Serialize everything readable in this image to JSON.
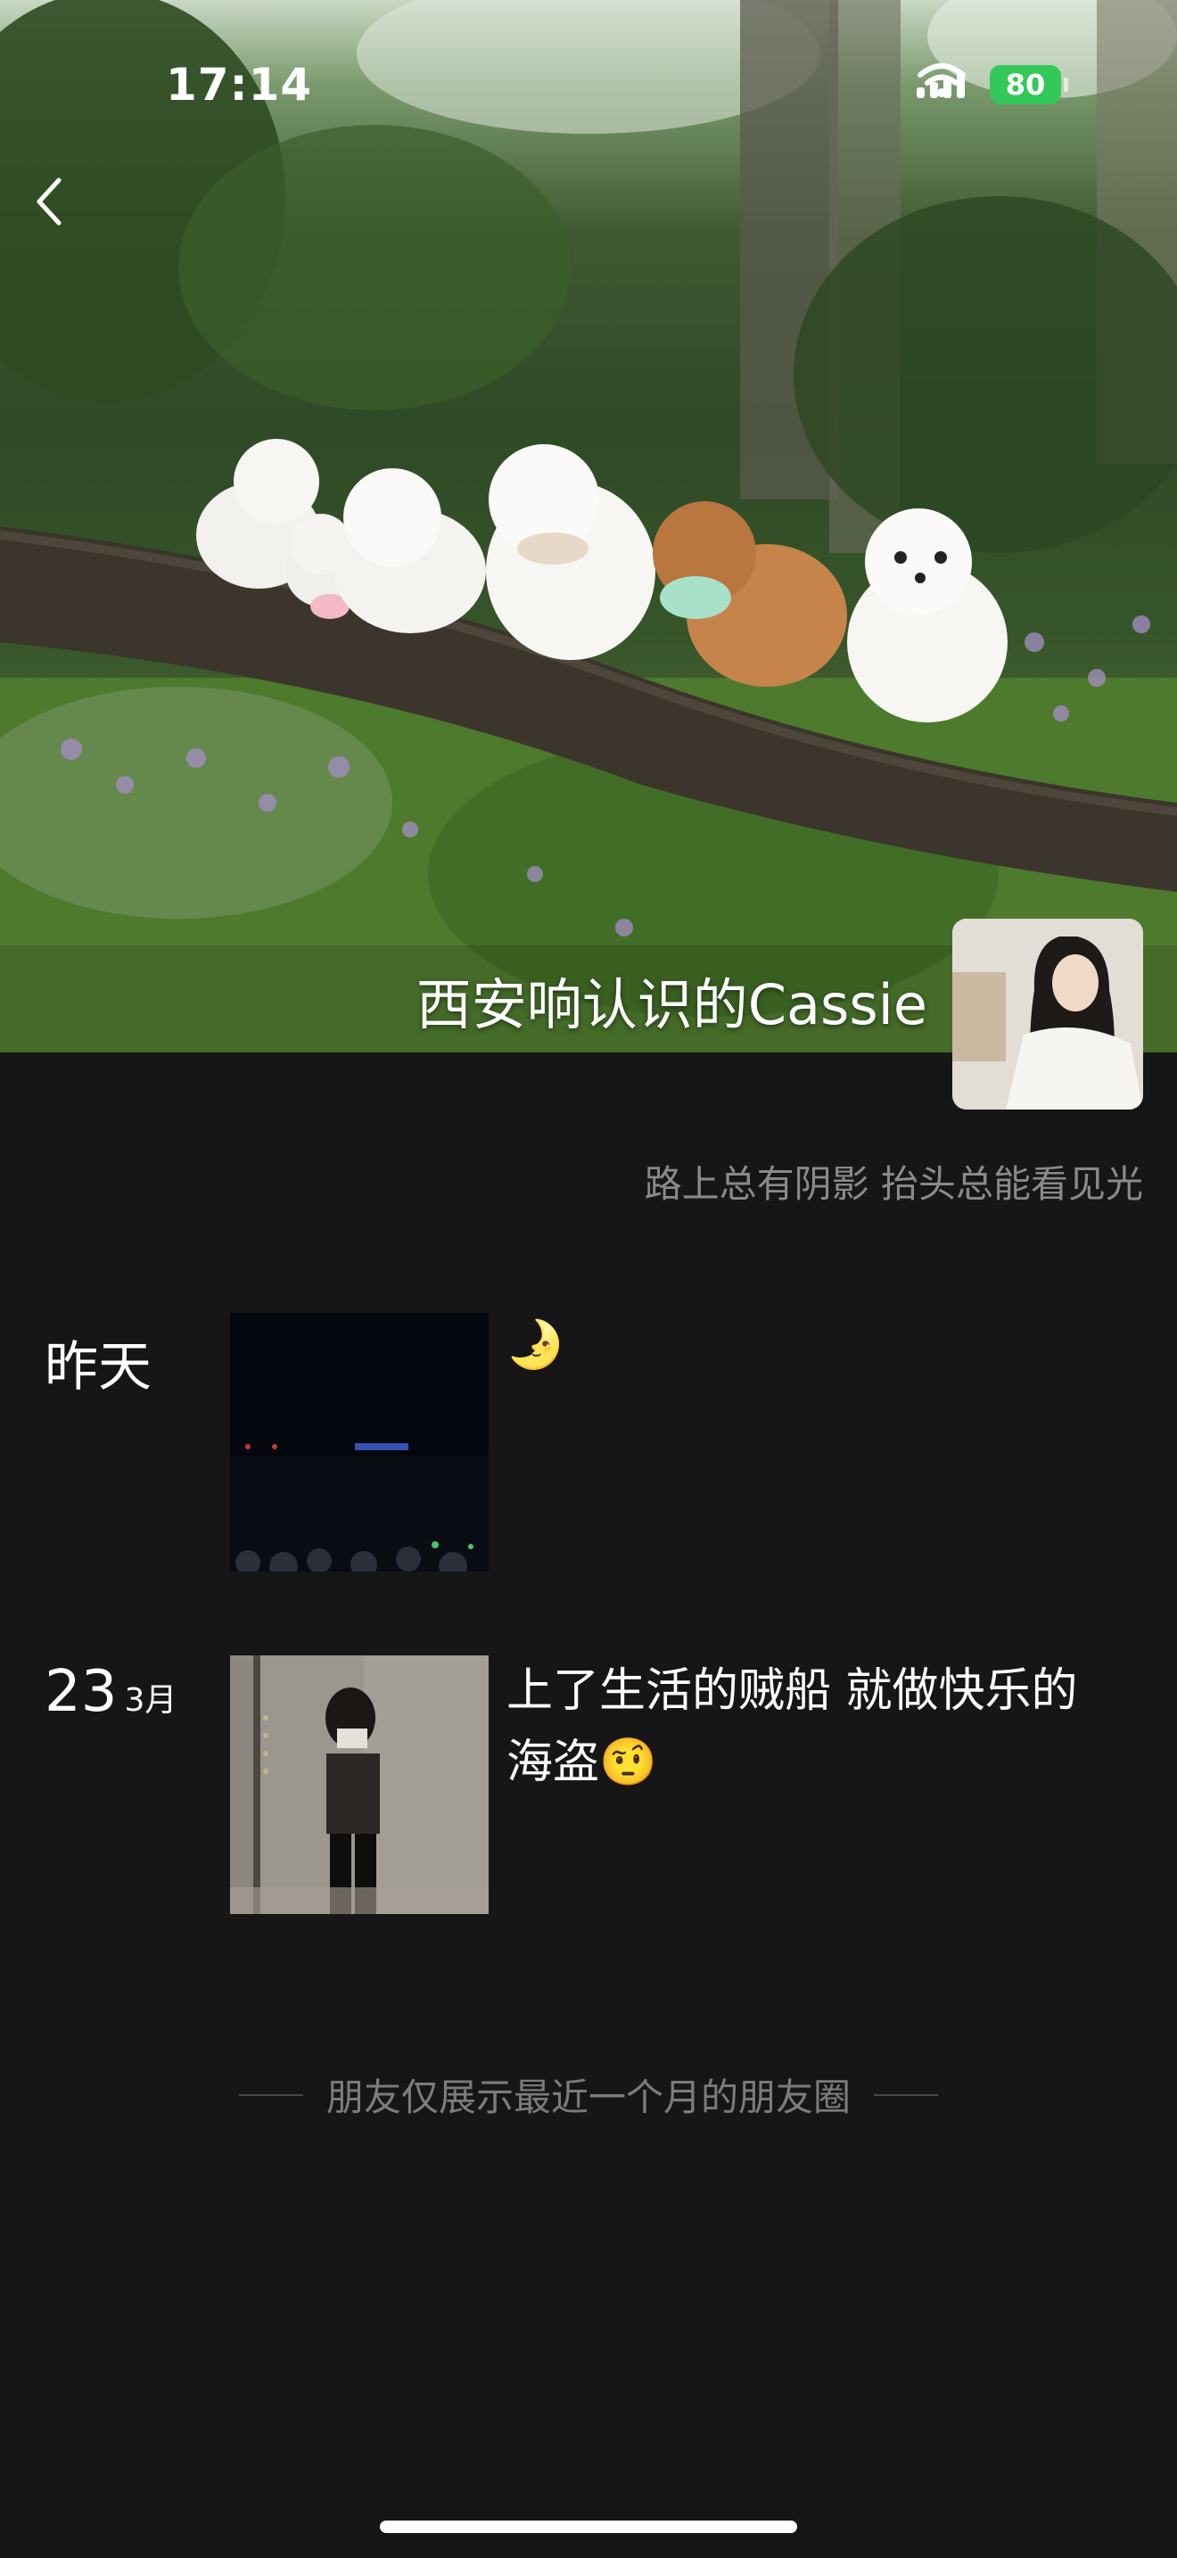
{
  "status_bar": {
    "time": "17:14",
    "battery": "80"
  },
  "cover": {
    "name": "西安响认识的Cassie",
    "signature": "路上总有阴影 抬头总能看见光"
  },
  "posts": [
    {
      "date": "昨天",
      "day": "",
      "month": "",
      "text": "🌛"
    },
    {
      "date": "",
      "day": "23",
      "month": "3月",
      "text": "上了生活的贼船 就做快乐的海盗🤨"
    }
  ],
  "footer": {
    "note": "朋友仅展示最近一个月的朋友圈"
  },
  "colors": {
    "background": "#161616",
    "battery": "#34c759",
    "muted_text": "#8a8a8a"
  }
}
